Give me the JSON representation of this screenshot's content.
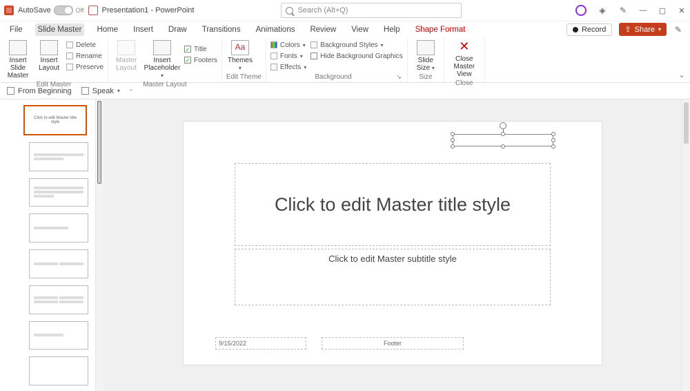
{
  "titlebar": {
    "autosave_label": "AutoSave",
    "autosave_state": "Off",
    "doc_title": "Presentation1 - PowerPoint",
    "search_placeholder": "Search (Alt+Q)"
  },
  "menu": {
    "items": [
      "File",
      "Slide Master",
      "Home",
      "Insert",
      "Draw",
      "Transitions",
      "Animations",
      "Review",
      "View",
      "Help",
      "Shape Format"
    ],
    "active_index": 1,
    "accent_index": 10,
    "record": "Record",
    "share": "Share"
  },
  "ribbon": {
    "edit_master": {
      "insert_slide_master": "Insert Slide Master",
      "insert_layout": "Insert Layout",
      "delete": "Delete",
      "rename": "Rename",
      "preserve": "Preserve",
      "group": "Edit Master"
    },
    "master_layout": {
      "master_layout": "Master Layout",
      "insert_placeholder": "Insert Placeholder",
      "title": "Title",
      "footers": "Footers",
      "group": "Master Layout"
    },
    "edit_theme": {
      "themes": "Themes",
      "group": "Edit Theme"
    },
    "background": {
      "colors": "Colors",
      "fonts": "Fonts",
      "effects": "Effects",
      "bg_styles": "Background Styles",
      "hide_bg": "Hide Background Graphics",
      "group": "Background"
    },
    "size": {
      "slide_size": "Slide Size",
      "group": "Size"
    },
    "close": {
      "close_master": "Close Master View",
      "group": "Close"
    }
  },
  "toolbar2": {
    "from_beginning": "From Beginning",
    "speak": "Speak"
  },
  "canvas": {
    "title_placeholder": "Click to edit Master title style",
    "subtitle_placeholder": "Click to edit Master subtitle style",
    "date_text": "9/15/2022",
    "footer_text": "Footer"
  },
  "thumbnails": {
    "master_label": "Click to edit Master title style"
  }
}
